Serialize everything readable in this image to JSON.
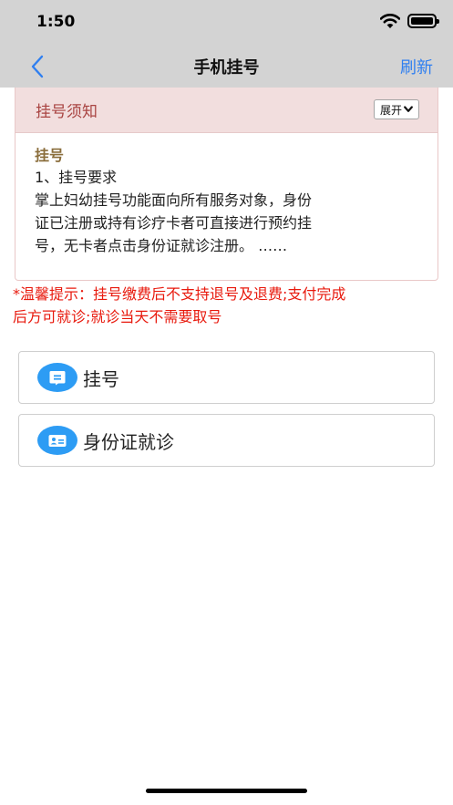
{
  "status_bar": {
    "time": "1:50"
  },
  "nav": {
    "title": "手机挂号",
    "refresh_label": "刷新"
  },
  "notice": {
    "title": "挂号须知",
    "expand_label": "展开",
    "section_title": "挂号",
    "lines": [
      "1、挂号要求",
      "掌上妇幼挂号功能面向所有服务对象，身份",
      "证已注册或持有诊疗卡者可直接进行预约挂",
      "号，无卡者点击身份证就诊注册。 ……"
    ]
  },
  "tip": {
    "lines": [
      "*温馨提示：挂号缴费后不支持退号及退费;支付完成",
      "后方可就诊;就诊当天不需要取号"
    ]
  },
  "options": [
    {
      "label": "挂号",
      "icon": "message-icon"
    },
    {
      "label": "身份证就诊",
      "icon": "id-card-icon"
    }
  ],
  "colors": {
    "accent": "#2f7ff0",
    "icon_bg": "#2d9cf4",
    "notice_header_bg": "#f2dede",
    "notice_title": "#a94442",
    "section_title": "#8a6d3b",
    "tip": "#e8190d"
  }
}
